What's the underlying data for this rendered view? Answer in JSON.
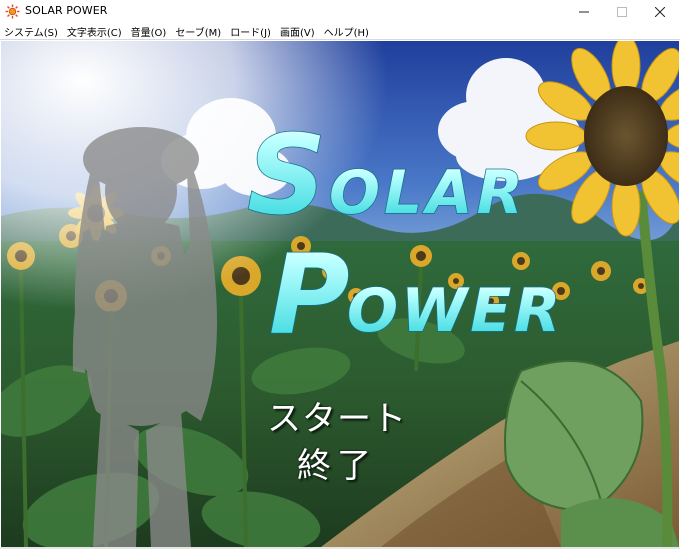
{
  "window": {
    "title": "SOLAR POWER",
    "icon": "sun-app-icon",
    "buttons": [
      "minimize-icon",
      "maximize-icon",
      "close-icon"
    ]
  },
  "menubar": {
    "items": [
      {
        "label": "システム(S)"
      },
      {
        "label": "文字表示(C)"
      },
      {
        "label": "音量(O)"
      },
      {
        "label": "セーブ(M)"
      },
      {
        "label": "ロード(J)"
      },
      {
        "label": "画面(V)"
      },
      {
        "label": "ヘルプ(H)"
      }
    ]
  },
  "game": {
    "logo_line1": "SOLAR",
    "logo_line2": "POWER",
    "title_menu": {
      "start": "スタート",
      "quit": "終了"
    },
    "colors": {
      "logo_cyan": "#3fe3e6",
      "sky_blue": "#2f4fa8",
      "sunflower_yellow": "#e8b72a"
    }
  }
}
